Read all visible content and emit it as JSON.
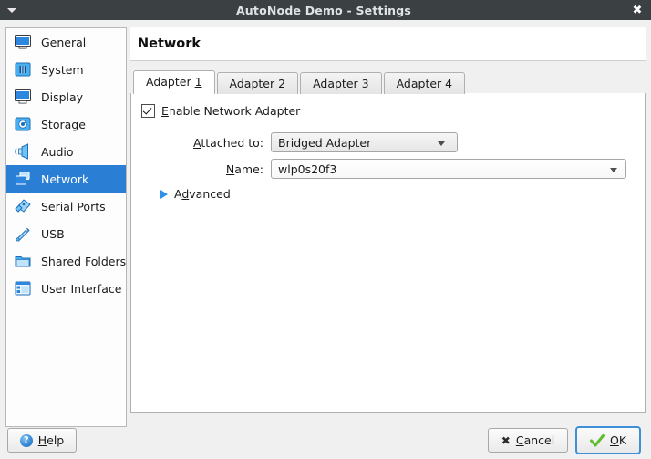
{
  "window": {
    "title": "AutoNode Demo - Settings",
    "menu_icon": "caret-down-icon",
    "close_icon": "close-icon",
    "titlebar_color": "#3b4043"
  },
  "sidebar": {
    "selected": "Network",
    "selection_color": "#2a7fd4",
    "items": [
      {
        "label": "General",
        "icon": "monitor-icon"
      },
      {
        "label": "System",
        "icon": "chip-icon"
      },
      {
        "label": "Display",
        "icon": "display-icon"
      },
      {
        "label": "Storage",
        "icon": "harddisk-icon"
      },
      {
        "label": "Audio",
        "icon": "speaker-icon"
      },
      {
        "label": "Network",
        "icon": "network-icon"
      },
      {
        "label": "Serial Ports",
        "icon": "serial-port-icon"
      },
      {
        "label": "USB",
        "icon": "usb-icon"
      },
      {
        "label": "Shared Folders",
        "icon": "folder-icon"
      },
      {
        "label": "User Interface",
        "icon": "window-layout-icon"
      }
    ]
  },
  "page": {
    "title": "Network",
    "tabs": [
      {
        "label": "Adapter 1",
        "accel": "1",
        "active": true
      },
      {
        "label": "Adapter 2",
        "accel": "2",
        "active": false
      },
      {
        "label": "Adapter 3",
        "accel": "3",
        "active": false
      },
      {
        "label": "Adapter 4",
        "accel": "4",
        "active": false
      }
    ],
    "enable_adapter": {
      "label": "Enable Network Adapter",
      "accel": "E",
      "checked": true
    },
    "attached_to": {
      "label": "Attached to:",
      "accel": "A",
      "value": "Bridged Adapter",
      "arrow_icon": "chevron-down-icon"
    },
    "name": {
      "label": "Name:",
      "accel": "N",
      "value": "wlp0s20f3",
      "arrow_icon": "chevron-down-icon"
    },
    "advanced": {
      "label": "Advanced",
      "accel": "d",
      "expanded": false,
      "icon": "triangle-right-icon"
    }
  },
  "footer": {
    "help": {
      "label": "Help",
      "accel": "H",
      "icon": "question-icon"
    },
    "cancel": {
      "label": "Cancel",
      "accel": "C",
      "icon": "x-icon"
    },
    "ok": {
      "label": "OK",
      "accel": "O",
      "icon": "checkmark-icon",
      "focus_color": "#3d8fd8"
    }
  }
}
